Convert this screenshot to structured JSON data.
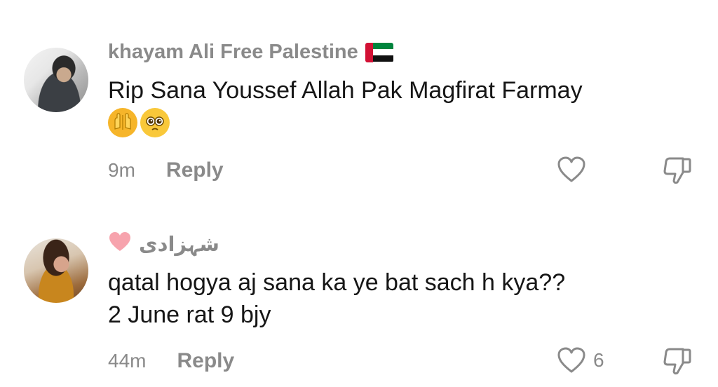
{
  "comments": [
    {
      "username": "khayam Ali Free Palestine",
      "username_badge": "uae-flag",
      "text_lines": [
        "Rip Sana Youssef Allah Pak Magfirat Farmay"
      ],
      "emojis": [
        "praying-hands",
        "pleading-face"
      ],
      "time": "9m",
      "reply_label": "Reply",
      "like_count": ""
    },
    {
      "username": "شہزادی",
      "username_badge": "pink-heart",
      "text_lines": [
        "qatal hogya aj sana ka ye bat sach h kya??",
        "2 June rat 9 bjy"
      ],
      "emojis": [],
      "time": "44m",
      "reply_label": "Reply",
      "like_count": "6"
    }
  ],
  "colors": {
    "muted": "#8a8a8a",
    "text": "#161616",
    "background": "#ffffff"
  }
}
